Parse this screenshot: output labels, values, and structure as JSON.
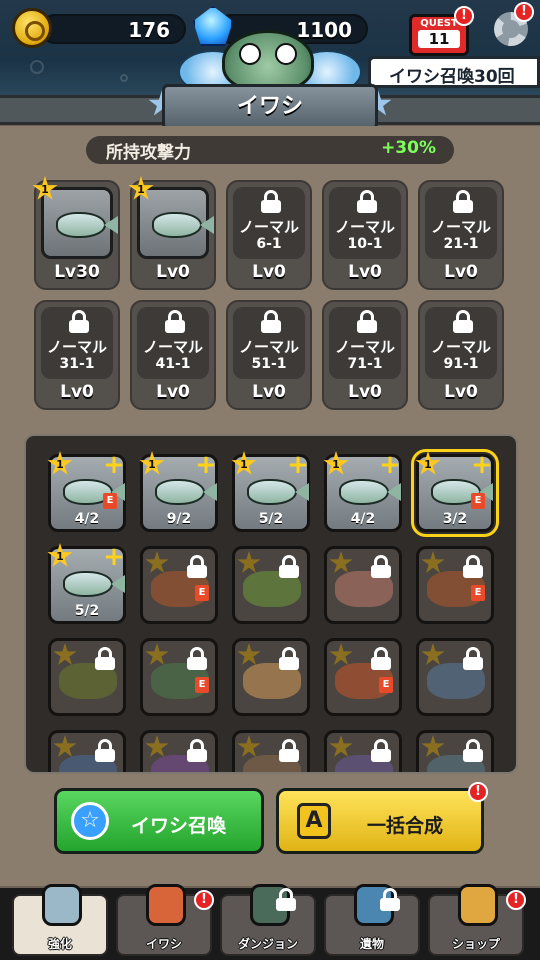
{
  "header": {
    "coins": "176",
    "gems": "1100",
    "quest_label": "QUEST",
    "quest_number": "11",
    "quest_text": "イワシ召喚30回",
    "character_name": "イワシ"
  },
  "attack": {
    "label": "所持攻撃力",
    "value": "+30%"
  },
  "collection": [
    {
      "owned": true,
      "rank": "1",
      "name": "",
      "stage": "",
      "level": "Lv30"
    },
    {
      "owned": true,
      "rank": "1",
      "name": "",
      "stage": "",
      "level": "Lv0"
    },
    {
      "owned": false,
      "name": "ノーマル",
      "stage": "6-1",
      "level": "Lv0"
    },
    {
      "owned": false,
      "name": "ノーマル",
      "stage": "10-1",
      "level": "Lv0"
    },
    {
      "owned": false,
      "name": "ノーマル",
      "stage": "21-1",
      "level": "Lv0"
    },
    {
      "owned": false,
      "name": "ノーマル",
      "stage": "31-1",
      "level": "Lv0"
    },
    {
      "owned": false,
      "name": "ノーマル",
      "stage": "41-1",
      "level": "Lv0"
    },
    {
      "owned": false,
      "name": "ノーマル",
      "stage": "51-1",
      "level": "Lv0"
    },
    {
      "owned": false,
      "name": "ノーマル",
      "stage": "71-1",
      "level": "Lv0"
    },
    {
      "owned": false,
      "name": "ノーマル",
      "stage": "91-1",
      "level": "Lv0"
    }
  ],
  "inventory": [
    {
      "owned": true,
      "rank": "1",
      "count": "4/2",
      "e": true
    },
    {
      "owned": true,
      "rank": "1",
      "count": "9/2",
      "e": false
    },
    {
      "owned": true,
      "rank": "1",
      "count": "5/2",
      "e": false
    },
    {
      "owned": true,
      "rank": "1",
      "count": "4/2",
      "e": false
    },
    {
      "owned": true,
      "rank": "1",
      "count": "3/2",
      "e": true,
      "selected": true
    },
    {
      "owned": true,
      "rank": "1",
      "count": "5/2",
      "e": false
    },
    {
      "owned": false,
      "e": true,
      "tint": "#b0562a"
    },
    {
      "owned": false,
      "e": false,
      "tint": "#6d9a3a"
    },
    {
      "owned": false,
      "e": false,
      "tint": "#c07a6a"
    },
    {
      "owned": false,
      "e": true,
      "tint": "#b0562a"
    },
    {
      "owned": false,
      "e": false,
      "tint": "#6b7a2a"
    },
    {
      "owned": false,
      "e": true,
      "tint": "#4a7a4a"
    },
    {
      "owned": false,
      "e": false,
      "tint": "#d59a5a"
    },
    {
      "owned": false,
      "e": true,
      "tint": "#c8552a"
    },
    {
      "owned": false,
      "e": false,
      "tint": "#5a7aa0"
    },
    {
      "owned": false,
      "e": false,
      "tint": "#4a6a9a"
    },
    {
      "owned": false,
      "e": false,
      "tint": "#7a4a9a"
    },
    {
      "owned": false,
      "e": false,
      "tint": "#8a6a4a"
    },
    {
      "owned": false,
      "e": false,
      "tint": "#6a5a9a"
    },
    {
      "owned": false,
      "e": false,
      "tint": "#5a7a8a"
    }
  ],
  "buttons": {
    "summon": "イワシ召喚",
    "merge": "一括合成",
    "merge_badge": "!"
  },
  "nav": [
    {
      "label": "強化",
      "icon": "ufo-icon",
      "active": true
    },
    {
      "label": "イワシ",
      "icon": "fish-emblem-icon",
      "badge": "!"
    },
    {
      "label": "ダンジョン",
      "icon": "gate-icon",
      "locked": true
    },
    {
      "label": "遺物",
      "icon": "vase-icon",
      "locked": true
    },
    {
      "label": "ショップ",
      "icon": "shop-icon",
      "badge": "!"
    }
  ],
  "colors": {
    "accent_green": "#24a52e",
    "accent_yellow": "#e0b315",
    "badge_red": "#e52323",
    "attack_value": "#7cff5a"
  }
}
